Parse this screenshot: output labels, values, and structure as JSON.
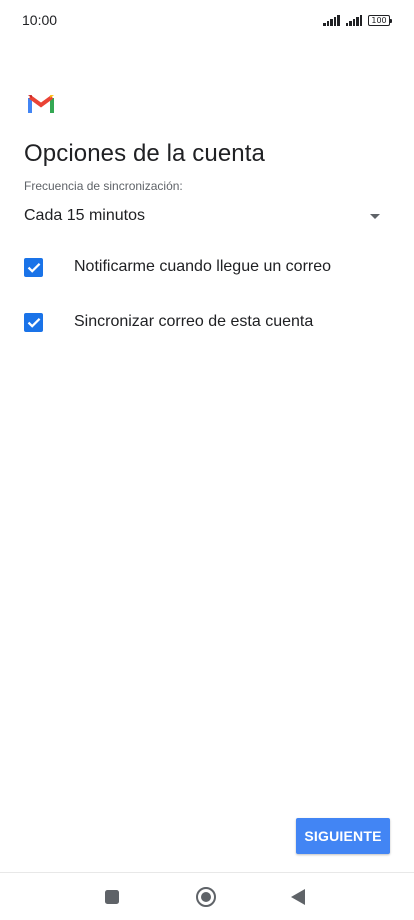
{
  "status_bar": {
    "time": "10:00",
    "battery": "100",
    "icons": [
      "signal-icon",
      "signal-icon",
      "battery-icon"
    ]
  },
  "app": {
    "logo_icon": "gmail-logo-icon",
    "colors": {
      "red": "#EA4335",
      "blue": "#4285F4",
      "green": "#34A853",
      "yellow": "#FBBC04"
    }
  },
  "main": {
    "title": "Opciones de la cuenta",
    "sync_label": "Frecuencia de sincronización:",
    "sync_value": "Cada 15 minutos",
    "checkboxes": [
      {
        "label": "Notificarme cuando llegue un correo",
        "checked": true
      },
      {
        "label": "Sincronizar correo de esta cuenta",
        "checked": true
      }
    ]
  },
  "footer": {
    "next_label": "SIGUIENTE",
    "accent": "#4285F4"
  },
  "nav_bar": {
    "icons": [
      "recents-icon",
      "home-icon",
      "back-icon"
    ]
  }
}
